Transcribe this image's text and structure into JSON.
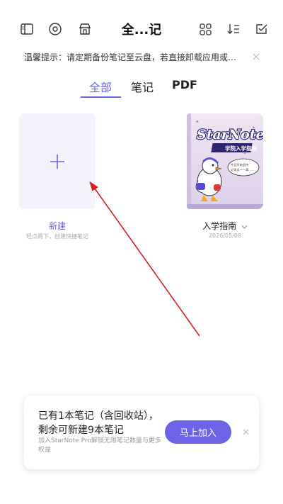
{
  "header": {
    "title": "全...记"
  },
  "notice": {
    "text": "温馨提示：请定期备份笔记至云盘，若直接卸载应用或重..."
  },
  "tabs": [
    {
      "label": "全部",
      "active": true
    },
    {
      "label": "笔记",
      "active": false
    },
    {
      "label": "PDF",
      "active": false
    }
  ],
  "new_note": {
    "label": "新建",
    "hint": "轻点两下，创建快捷笔记"
  },
  "notebook": {
    "cover_title": "StarNote",
    "cover_subtitle": "学院入学指南",
    "cover_bubble_line1": "今日开始坚持",
    "cover_bubble_line2": "记录点一一滴……",
    "name": "入学指南",
    "date": "2026/05/08"
  },
  "promo": {
    "line1": "已有1本笔记（含回收站），",
    "line2": "剩余可新建9本笔记",
    "desc": "加入StarNote Pro解锁无限笔记数量与更多权益",
    "button": "马上加入"
  },
  "colors": {
    "accent": "#6b66e8",
    "arrow": "#d91f1f"
  }
}
